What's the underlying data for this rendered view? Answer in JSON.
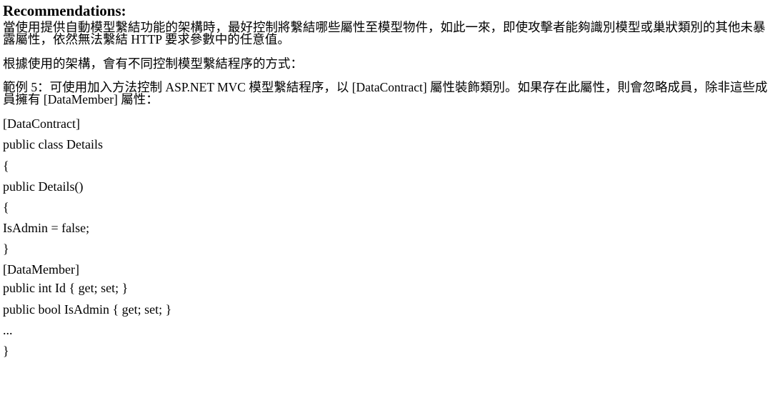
{
  "document": {
    "title": "Recommendations:",
    "paragraphs": [
      "當使用提供自動模型繫結功能的架構時，最好控制將繫結哪些屬性至模型物件，如此一來，即使攻擊者能夠識別模型或巢狀類別的其他未暴露屬性，依然無法繫結 HTTP 要求參數中的任意值。",
      "根據使用的架構，會有不同控制模型繫結程序的方式：",
      "範例 5：可使用加入方法控制 ASP.NET MVC 模型繫結程序，以 [DataContract] 屬性裝飾類別。如果存在此屬性，則會忽略成員，除非這些成員擁有 [DataMember] 屬性："
    ],
    "code_lines": [
      "[DataContract]",
      "public class Details",
      "{",
      "public Details()",
      "{",
      "IsAdmin = false;",
      "}",
      "[DataMember]",
      "public int Id { get; set; }",
      "public bool IsAdmin { get; set; }",
      "...",
      "}"
    ]
  }
}
